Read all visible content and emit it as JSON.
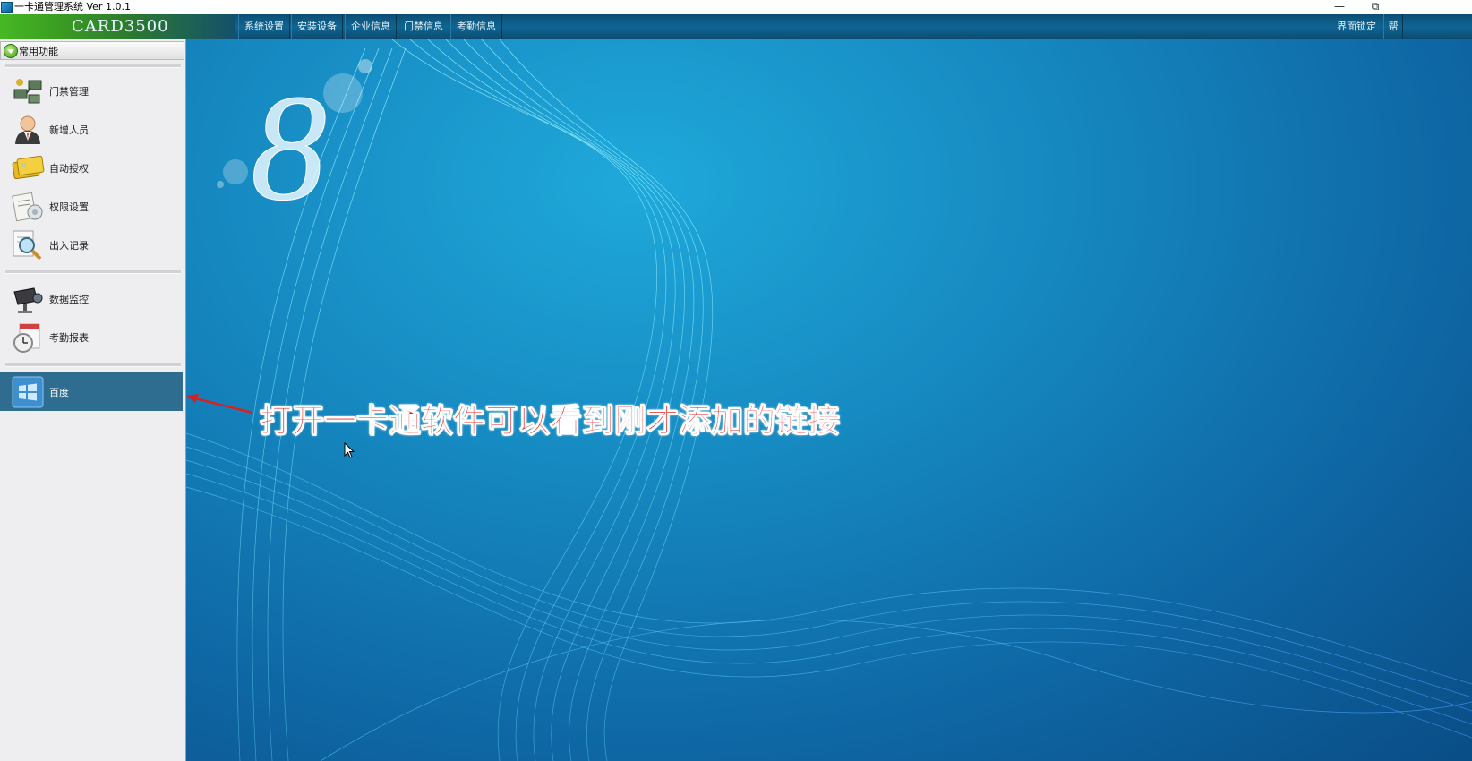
{
  "window": {
    "title": "一卡通管理系统  Ver 1.0.1",
    "minimize_glyph": "—",
    "restore_glyph": "⧉"
  },
  "menubar": {
    "brand": "CARD3500",
    "items": [
      {
        "label": "系统设置"
      },
      {
        "label": "安装设备"
      },
      {
        "label": "企业信息"
      },
      {
        "label": "门禁信息"
      },
      {
        "label": "考勤信息"
      }
    ],
    "right_items": [
      {
        "label": "界面锁定"
      },
      {
        "label": "帮"
      }
    ]
  },
  "sidebar": {
    "header": "常用功能",
    "items": [
      {
        "label": "门禁管理",
        "icon": "access-control-icon"
      },
      {
        "label": "新增人员",
        "icon": "person-icon"
      },
      {
        "label": "自动授权",
        "icon": "card-icon"
      },
      {
        "label": "权限设置",
        "icon": "permission-icon"
      },
      {
        "label": "出入记录",
        "icon": "record-search-icon"
      },
      {
        "label": "数据监控",
        "icon": "camera-icon"
      },
      {
        "label": "考勤报表",
        "icon": "attendance-clock-icon"
      },
      {
        "label": "百度",
        "icon": "windows-icon"
      }
    ]
  },
  "main": {
    "logo_digit": "8",
    "annotation": "打开一卡通软件可以看到刚才添加的链接"
  },
  "colors": {
    "accent_red": "#e02020",
    "menubar": "#0f6593",
    "brand_green": "#46b824",
    "active_item": "#2e6d8f"
  }
}
